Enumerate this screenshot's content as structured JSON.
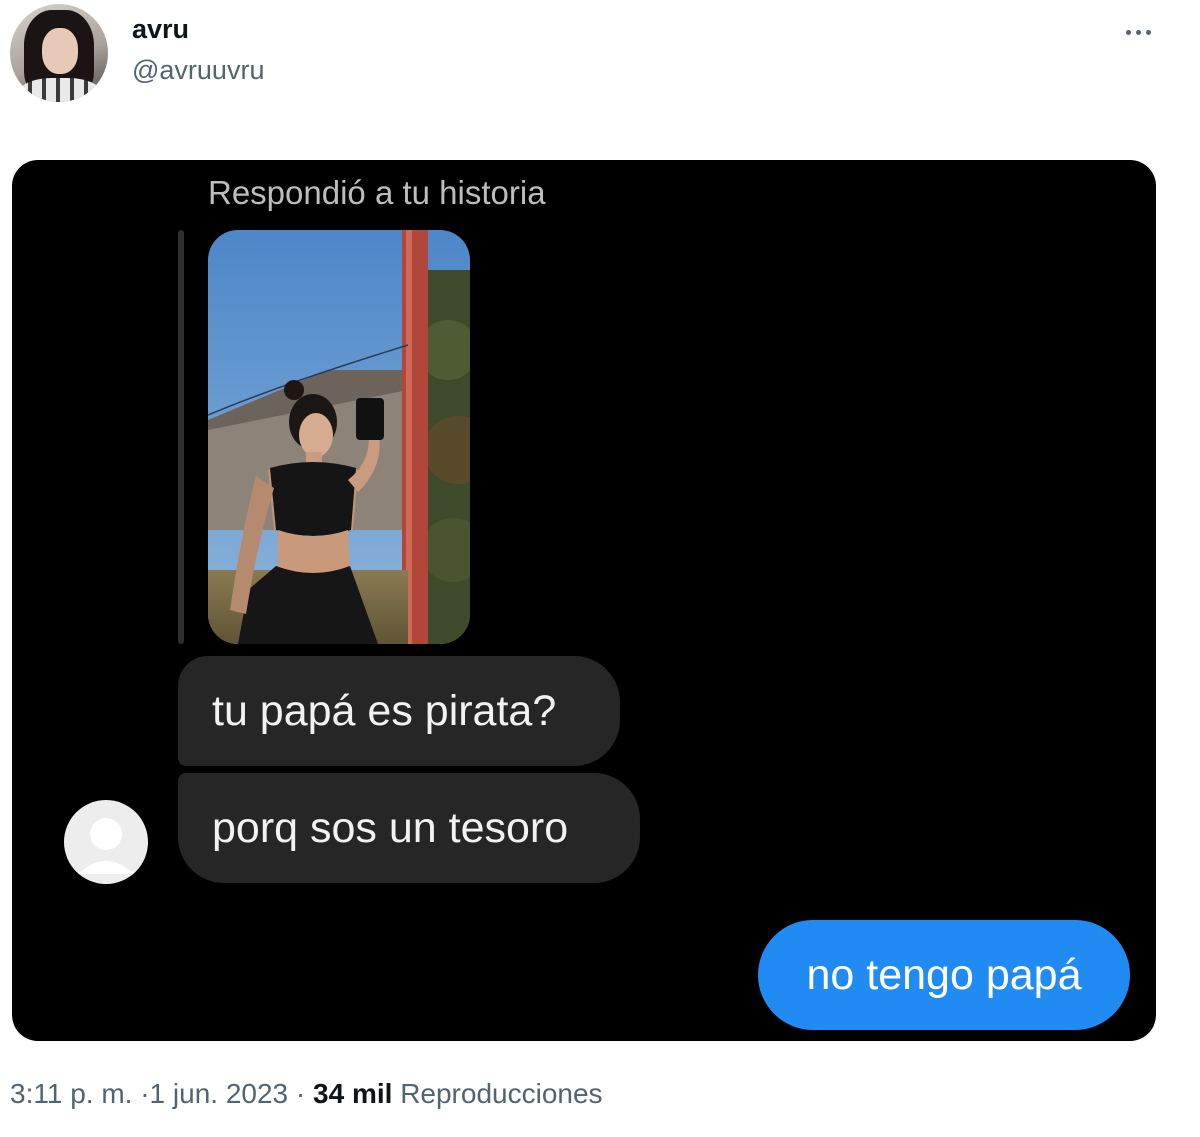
{
  "tweet": {
    "author_name": "avru",
    "author_handle": "@avruuvru",
    "more_icon": "more-horizontal-icon"
  },
  "screenshot": {
    "reply_label": "Respondió a tu historia",
    "incoming_messages": [
      "tu papá es pirata?",
      "porq sos un tesoro"
    ],
    "outgoing_message": "no tengo papá",
    "colors": {
      "background": "#000000",
      "incoming_bubble": "#262626",
      "outgoing_bubble": "#1f8bf3"
    }
  },
  "footer": {
    "time": "3:11 p. m.",
    "separator": "·",
    "date": "1 jun. 2023",
    "views_count": "34 mil",
    "views_label": "Reproducciones"
  }
}
